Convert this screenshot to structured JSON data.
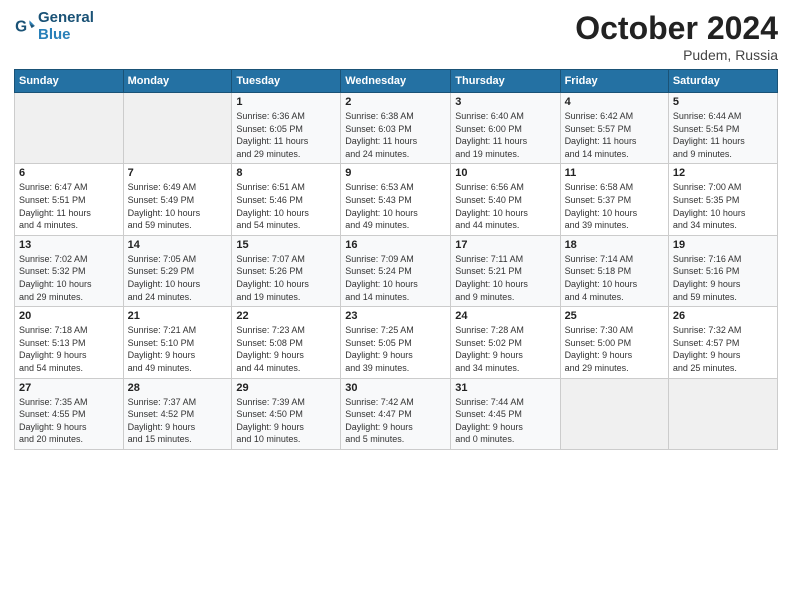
{
  "header": {
    "logo_line1": "General",
    "logo_line2": "Blue",
    "month": "October 2024",
    "location": "Pudem, Russia"
  },
  "weekdays": [
    "Sunday",
    "Monday",
    "Tuesday",
    "Wednesday",
    "Thursday",
    "Friday",
    "Saturday"
  ],
  "weeks": [
    [
      {
        "day": "",
        "info": ""
      },
      {
        "day": "",
        "info": ""
      },
      {
        "day": "1",
        "info": "Sunrise: 6:36 AM\nSunset: 6:05 PM\nDaylight: 11 hours\nand 29 minutes."
      },
      {
        "day": "2",
        "info": "Sunrise: 6:38 AM\nSunset: 6:03 PM\nDaylight: 11 hours\nand 24 minutes."
      },
      {
        "day": "3",
        "info": "Sunrise: 6:40 AM\nSunset: 6:00 PM\nDaylight: 11 hours\nand 19 minutes."
      },
      {
        "day": "4",
        "info": "Sunrise: 6:42 AM\nSunset: 5:57 PM\nDaylight: 11 hours\nand 14 minutes."
      },
      {
        "day": "5",
        "info": "Sunrise: 6:44 AM\nSunset: 5:54 PM\nDaylight: 11 hours\nand 9 minutes."
      }
    ],
    [
      {
        "day": "6",
        "info": "Sunrise: 6:47 AM\nSunset: 5:51 PM\nDaylight: 11 hours\nand 4 minutes."
      },
      {
        "day": "7",
        "info": "Sunrise: 6:49 AM\nSunset: 5:49 PM\nDaylight: 10 hours\nand 59 minutes."
      },
      {
        "day": "8",
        "info": "Sunrise: 6:51 AM\nSunset: 5:46 PM\nDaylight: 10 hours\nand 54 minutes."
      },
      {
        "day": "9",
        "info": "Sunrise: 6:53 AM\nSunset: 5:43 PM\nDaylight: 10 hours\nand 49 minutes."
      },
      {
        "day": "10",
        "info": "Sunrise: 6:56 AM\nSunset: 5:40 PM\nDaylight: 10 hours\nand 44 minutes."
      },
      {
        "day": "11",
        "info": "Sunrise: 6:58 AM\nSunset: 5:37 PM\nDaylight: 10 hours\nand 39 minutes."
      },
      {
        "day": "12",
        "info": "Sunrise: 7:00 AM\nSunset: 5:35 PM\nDaylight: 10 hours\nand 34 minutes."
      }
    ],
    [
      {
        "day": "13",
        "info": "Sunrise: 7:02 AM\nSunset: 5:32 PM\nDaylight: 10 hours\nand 29 minutes."
      },
      {
        "day": "14",
        "info": "Sunrise: 7:05 AM\nSunset: 5:29 PM\nDaylight: 10 hours\nand 24 minutes."
      },
      {
        "day": "15",
        "info": "Sunrise: 7:07 AM\nSunset: 5:26 PM\nDaylight: 10 hours\nand 19 minutes."
      },
      {
        "day": "16",
        "info": "Sunrise: 7:09 AM\nSunset: 5:24 PM\nDaylight: 10 hours\nand 14 minutes."
      },
      {
        "day": "17",
        "info": "Sunrise: 7:11 AM\nSunset: 5:21 PM\nDaylight: 10 hours\nand 9 minutes."
      },
      {
        "day": "18",
        "info": "Sunrise: 7:14 AM\nSunset: 5:18 PM\nDaylight: 10 hours\nand 4 minutes."
      },
      {
        "day": "19",
        "info": "Sunrise: 7:16 AM\nSunset: 5:16 PM\nDaylight: 9 hours\nand 59 minutes."
      }
    ],
    [
      {
        "day": "20",
        "info": "Sunrise: 7:18 AM\nSunset: 5:13 PM\nDaylight: 9 hours\nand 54 minutes."
      },
      {
        "day": "21",
        "info": "Sunrise: 7:21 AM\nSunset: 5:10 PM\nDaylight: 9 hours\nand 49 minutes."
      },
      {
        "day": "22",
        "info": "Sunrise: 7:23 AM\nSunset: 5:08 PM\nDaylight: 9 hours\nand 44 minutes."
      },
      {
        "day": "23",
        "info": "Sunrise: 7:25 AM\nSunset: 5:05 PM\nDaylight: 9 hours\nand 39 minutes."
      },
      {
        "day": "24",
        "info": "Sunrise: 7:28 AM\nSunset: 5:02 PM\nDaylight: 9 hours\nand 34 minutes."
      },
      {
        "day": "25",
        "info": "Sunrise: 7:30 AM\nSunset: 5:00 PM\nDaylight: 9 hours\nand 29 minutes."
      },
      {
        "day": "26",
        "info": "Sunrise: 7:32 AM\nSunset: 4:57 PM\nDaylight: 9 hours\nand 25 minutes."
      }
    ],
    [
      {
        "day": "27",
        "info": "Sunrise: 7:35 AM\nSunset: 4:55 PM\nDaylight: 9 hours\nand 20 minutes."
      },
      {
        "day": "28",
        "info": "Sunrise: 7:37 AM\nSunset: 4:52 PM\nDaylight: 9 hours\nand 15 minutes."
      },
      {
        "day": "29",
        "info": "Sunrise: 7:39 AM\nSunset: 4:50 PM\nDaylight: 9 hours\nand 10 minutes."
      },
      {
        "day": "30",
        "info": "Sunrise: 7:42 AM\nSunset: 4:47 PM\nDaylight: 9 hours\nand 5 minutes."
      },
      {
        "day": "31",
        "info": "Sunrise: 7:44 AM\nSunset: 4:45 PM\nDaylight: 9 hours\nand 0 minutes."
      },
      {
        "day": "",
        "info": ""
      },
      {
        "day": "",
        "info": ""
      }
    ]
  ]
}
